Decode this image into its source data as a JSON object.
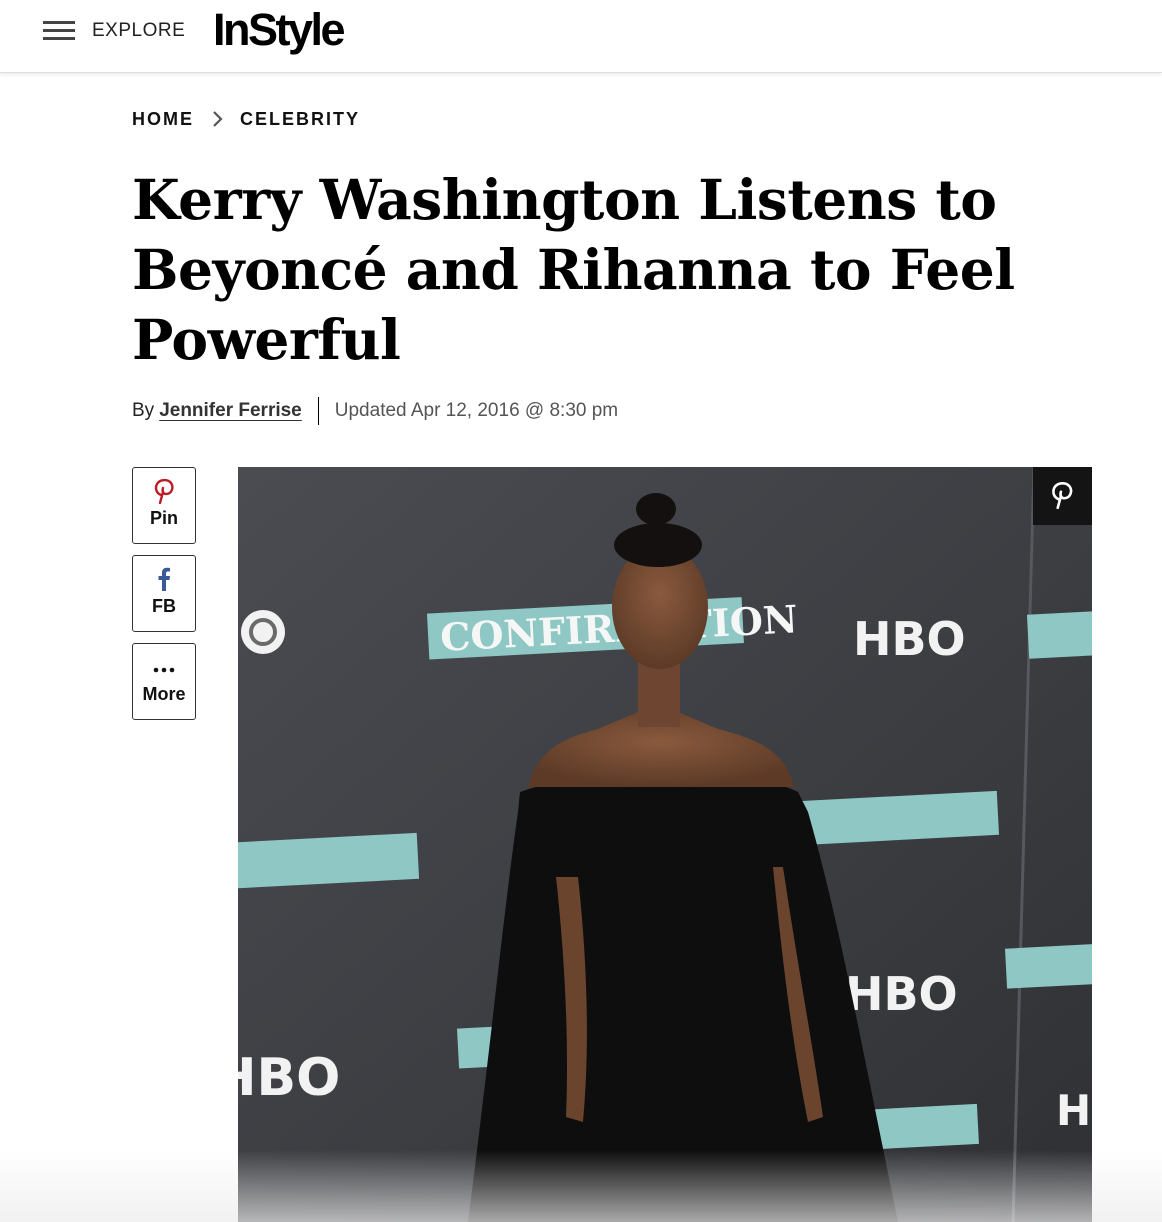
{
  "header": {
    "menu_label": "EXPLORE",
    "logo_text": "InStyle"
  },
  "breadcrumb": {
    "items": [
      "HOME",
      "CELEBRITY"
    ]
  },
  "article": {
    "title": "Kerry Washington Listens to Beyoncé and Rihanna to Feel Powerful",
    "byline_prefix": "By",
    "author": "Jennifer Ferrise",
    "updated": "Updated Apr 12, 2016 @ 8:30 pm"
  },
  "share": {
    "pin_label": "Pin",
    "fb_label": "FB",
    "more_label": "More"
  },
  "hero_image": {
    "backdrop_text": {
      "confirmation": "CONFIRMATION",
      "hbo": "HBO"
    }
  },
  "colors": {
    "pinterest": "#bd1c26",
    "facebook": "#3b5998",
    "backdrop": "#3a3c40",
    "banner": "#8ec7c4"
  },
  "icons": {
    "menu": "hamburger-icon",
    "breadcrumb_separator": "chevron-right-icon",
    "pin": "pinterest-icon",
    "fb": "facebook-icon",
    "more": "more-dots-icon"
  }
}
